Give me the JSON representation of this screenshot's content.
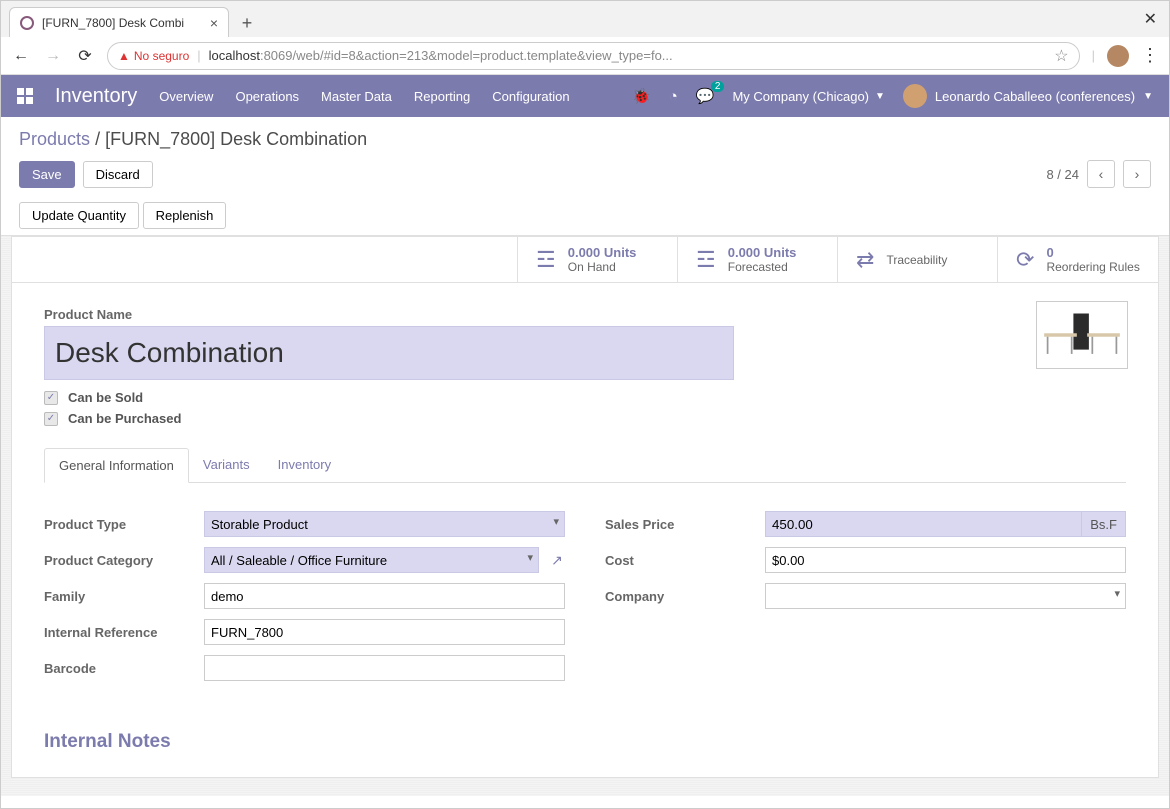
{
  "browser": {
    "tab_title": "[FURN_7800] Desk Combi",
    "insecure_label": "No seguro",
    "url_prefix": "localhost",
    "url_rest": ":8069/web/#id=8&action=213&model=product.template&view_type=fo..."
  },
  "nav": {
    "app": "Inventory",
    "links": [
      "Overview",
      "Operations",
      "Master Data",
      "Reporting",
      "Configuration"
    ],
    "msg_badge": "2",
    "company": "My Company (Chicago)",
    "user": "Leonardo Caballeeo (conferences)"
  },
  "breadcrumb": {
    "root": "Products",
    "current": "[FURN_7800] Desk Combination"
  },
  "buttons": {
    "save": "Save",
    "discard": "Discard",
    "update_qty": "Update Quantity",
    "replenish": "Replenish"
  },
  "pager": {
    "text": "8 / 24"
  },
  "stats": {
    "onhand_val": "0.000 Units",
    "onhand_lbl": "On Hand",
    "forecast_val": "0.000 Units",
    "forecast_lbl": "Forecasted",
    "trace_lbl": "Traceability",
    "reorder_val": "0",
    "reorder_lbl": "Reordering Rules"
  },
  "form": {
    "name_label": "Product Name",
    "name_value": "Desk Combination",
    "can_sold": "Can be Sold",
    "can_purchased": "Can be Purchased"
  },
  "tabs": [
    "General Information",
    "Variants",
    "Inventory"
  ],
  "fields": {
    "product_type_lbl": "Product Type",
    "product_type_val": "Storable Product",
    "product_cat_lbl": "Product Category",
    "product_cat_val": "All / Saleable / Office Furniture",
    "family_lbl": "Family",
    "family_val": "demo",
    "internal_ref_lbl": "Internal Reference",
    "internal_ref_val": "FURN_7800",
    "barcode_lbl": "Barcode",
    "barcode_val": "",
    "sales_price_lbl": "Sales Price",
    "sales_price_val": "450.00",
    "sales_price_unit": "Bs.F",
    "cost_lbl": "Cost",
    "cost_val": "$0.00",
    "company_lbl": "Company",
    "company_val": ""
  },
  "section": {
    "internal_notes": "Internal Notes"
  }
}
